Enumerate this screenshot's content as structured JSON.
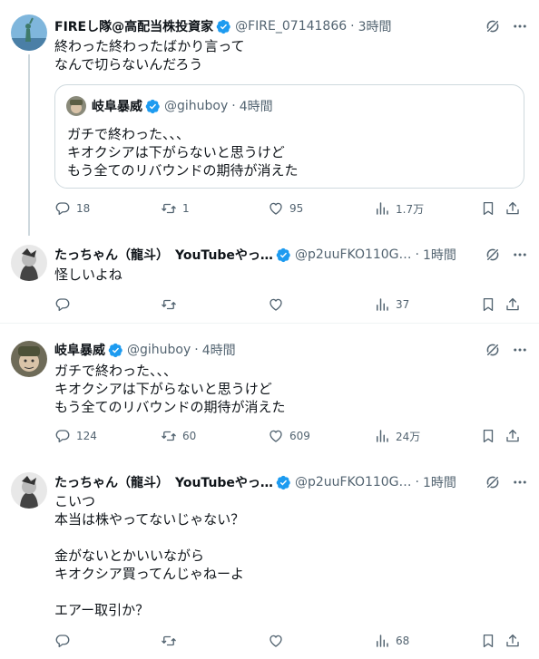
{
  "posts": [
    {
      "name": "FIREし隊@高配当株投資家",
      "handle": "@FIRE_07141866",
      "time": "3時間",
      "text": "終わった終わったばかり言って\nなんで切らないんだろう",
      "quote": {
        "name": "岐阜暴威",
        "handle": "@gihuboy",
        "time": "4時間",
        "text": "ガチで終わった、、、\nキオクシアは下がらないと思うけど\nもう全てのリバウンドの期待が消えた"
      },
      "replies": "18",
      "reposts": "1",
      "likes": "95",
      "views": "1.7万"
    },
    {
      "name": "たっちゃん（龍斗）　YouTubeやっ…",
      "handle": "@p2uuFKO110G…",
      "time": "1時間",
      "text": "怪しいよね",
      "replies": "",
      "reposts": "",
      "likes": "",
      "views": "37"
    },
    {
      "name": "岐阜暴威",
      "handle": "@gihuboy",
      "time": "4時間",
      "text": "ガチで終わった、、、\nキオクシアは下がらないと思うけど\nもう全てのリバウンドの期待が消えた",
      "replies": "124",
      "reposts": "60",
      "likes": "609",
      "views": "24万"
    },
    {
      "name": "たっちゃん（龍斗）　YouTubeやっ…",
      "handle": "@p2uuFKO110G…",
      "time": "1時間",
      "text": "こいつ\n本当は株やってないじゃない？\n\n金がないとかいいながら\nキオクシア買ってんじゃねーよ\n\nエアー取引か？",
      "replies": "",
      "reposts": "",
      "likes": "",
      "views": "68"
    }
  ],
  "meta": {
    "dot": "·",
    "icons": [
      "grok-icon",
      "more-icon",
      "reply-icon",
      "repost-icon",
      "like-icon",
      "views-icon",
      "bookmark-icon",
      "share-icon",
      "verified-badge-icon"
    ],
    "verified_color": "#1d9bf0"
  }
}
